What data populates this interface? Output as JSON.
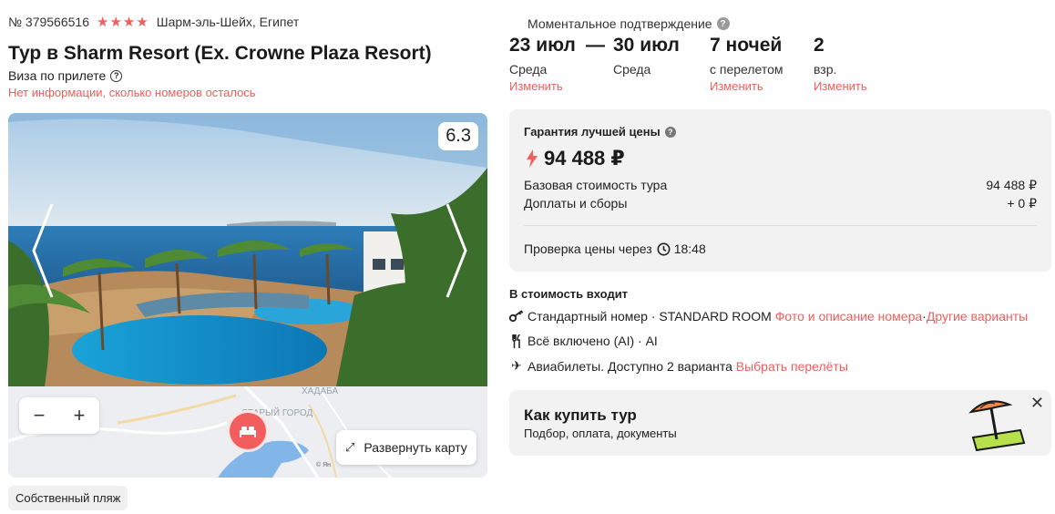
{
  "tour": {
    "number": "№ 379566516",
    "stars": 4,
    "location": "Шарм-эль-Шейх, Египет",
    "title": "Тур в Sharm Resort (Ex. Crowne Plaza Resort)",
    "visa": "Виза по прилете",
    "rooms_info": "Нет информации, сколько номеров осталось"
  },
  "gallery": {
    "rating": "6.3"
  },
  "map": {
    "label_khadaba": "ХАДАБА",
    "label_old_town": "СТАРЫЙ ГОРОД",
    "zoom_out": "−",
    "zoom_in": "+",
    "expand_label": "Развернуть карту",
    "copyright": "© Ян"
  },
  "features": {
    "beach": "Собственный пляж"
  },
  "booking": {
    "instant_confirm": "Моментальное подтверждение",
    "date_from": "23 июл",
    "date_from_day": "Среда",
    "date_to": "30 июл",
    "date_to_day": "Среда",
    "dash": "—",
    "nights": "7 ночей",
    "nights_sub": "с перелетом",
    "adults": "2",
    "adults_sub": "взр.",
    "change": "Изменить"
  },
  "price": {
    "guarantee": "Гарантия лучшей цены",
    "total": "94 488 ₽",
    "base_label": "Базовая стоимость тура",
    "base_value": "94 488 ₽",
    "extra_label": "Доплаты и сборы",
    "extra_value": "+ 0 ₽",
    "check_label": "Проверка цены через",
    "check_time": "18:48"
  },
  "included": {
    "title": "В стоимость входит",
    "room_text": "Стандартный номер · STANDARD ROOM",
    "room_link1": "Фото и описание номера",
    "room_sep": " · ",
    "room_link2": "Другие варианты",
    "meal_text": "Всё включено (AI) · AI",
    "flight_text": "Авиабилеты. Доступно 2 варианта",
    "flight_link": "Выбрать перелёты"
  },
  "howto": {
    "title": "Как купить тур",
    "subtitle": "Подбор, оплата, документы",
    "close": "✕"
  },
  "colors": {
    "accent": "#f25d5d",
    "panel": "#f2f2f2"
  }
}
